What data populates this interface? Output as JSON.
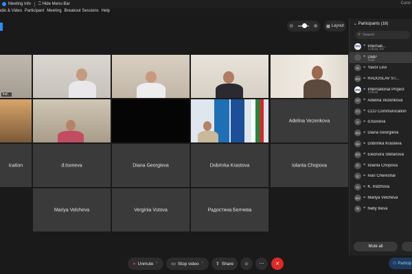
{
  "topbar": {
    "meeting_info": "Meeting Info",
    "hide_menu": "Hide Menu Bar",
    "right_text": "Conn"
  },
  "menu": [
    "udio & Video",
    "Participant",
    "Meeting",
    "Breakout Sessions",
    "Help"
  ],
  "view": {
    "layout_label": "Layout"
  },
  "tiles": {
    "r3c0": "ication",
    "r3c1": "d.tsoneva",
    "r3c2": "Diana Georgieva",
    "r3c3": "Dobrinka Krastova",
    "r3c4": "Iolanta Chopova",
    "r2c4": "Adelina Vezenkova",
    "r4c1": "Mariya Velcheva",
    "r4c2": "Verginia Vutova",
    "r4c3": "Радостина Белчева",
    "tag_r1c0": "lnd..."
  },
  "participants": {
    "title": "Participants (18)",
    "search_placeholder": "Search",
    "rows": [
      {
        "initials": "iPD",
        "name": "Internati...",
        "sub": "Cohost, me",
        "logo": true
      },
      {
        "initials": "",
        "name": "DMP",
        "sub": "Host",
        "selected": true
      },
      {
        "initials": "VL",
        "name": "Yavor Levi"
      },
      {
        "initials": "RS",
        "name": "RADOSLAV ST..."
      },
      {
        "initials": "iPD",
        "name": "International Project",
        "sub": "Cohost",
        "logo": true
      },
      {
        "initials": "AV",
        "name": "Adelina Vezenkova"
      },
      {
        "initials": "CC",
        "name": "CCU Communication"
      },
      {
        "initials": "D",
        "name": "d.tsoneva"
      },
      {
        "initials": "DG",
        "name": "Diana Georgieva"
      },
      {
        "initials": "DK",
        "name": "Dobrinka Krasteva"
      },
      {
        "initials": "ES",
        "name": "Eleonora Stefanova"
      },
      {
        "initials": "IC",
        "name": "Iolanta Chopova"
      },
      {
        "initials": "IC",
        "name": "Ivan Chereshar"
      },
      {
        "initials": "KI",
        "name": "K. Indzhova"
      },
      {
        "initials": "MV",
        "name": "Mariya Velcheva"
      },
      {
        "initials": "NI",
        "name": "Nelly Ilieva"
      }
    ],
    "mute_all": "Mute all",
    "tab_label": "Particip"
  },
  "toolbar": {
    "unmute": "Unmute",
    "stop_video": "Stop video",
    "share": "Share"
  }
}
